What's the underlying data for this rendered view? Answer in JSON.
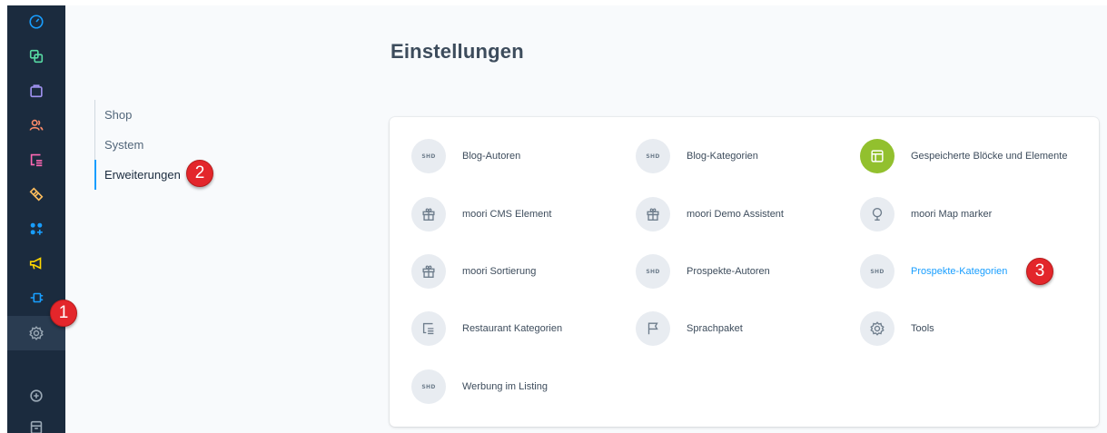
{
  "rail": {
    "items": [
      {
        "icon": "dashboard-icon",
        "color": "#189eff"
      },
      {
        "icon": "catalog-icon",
        "color": "#57d9a3"
      },
      {
        "icon": "orders-icon",
        "color": "#a092f0"
      },
      {
        "icon": "customers-icon",
        "color": "#ff8c6a"
      },
      {
        "icon": "content-icon",
        "color": "#ff68b4"
      },
      {
        "icon": "marketing-icon",
        "color": "#ffbd5d"
      },
      {
        "icon": "extensions-icon",
        "color": "#189eff"
      },
      {
        "icon": "promotions-icon",
        "color": "#ffd700"
      },
      {
        "icon": "plugins-icon",
        "color": "#189eff"
      },
      {
        "icon": "settings-icon",
        "color": "#9aa8b5"
      },
      {
        "icon": "add-icon",
        "color": "#9aa8b5"
      },
      {
        "icon": "sales-channel-icon",
        "color": "#9aa8b5"
      }
    ]
  },
  "settings": {
    "title": "Einstellungen",
    "tabs": [
      "Shop",
      "System",
      "Erweiterungen"
    ],
    "active_tab": "Erweiterungen"
  },
  "extensions": [
    {
      "label": "Blog-Autoren",
      "icon": "shd-icon",
      "icon_text": "SHD"
    },
    {
      "label": "Blog-Kategorien",
      "icon": "shd-icon",
      "icon_text": "SHD"
    },
    {
      "label": "Gespeicherte Blöcke und Elemente",
      "icon": "layout-icon",
      "icon_text": ""
    },
    {
      "label": "moori CMS Element",
      "icon": "gift-icon",
      "icon_text": ""
    },
    {
      "label": "moori Demo Assistent",
      "icon": "gift-icon",
      "icon_text": ""
    },
    {
      "label": "moori Map marker",
      "icon": "map-pin-icon",
      "icon_text": ""
    },
    {
      "label": "moori Sortierung",
      "icon": "gift-icon",
      "icon_text": ""
    },
    {
      "label": "Prospekte-Autoren",
      "icon": "shd-icon",
      "icon_text": "SHD"
    },
    {
      "label": "Prospekte-Kategorien",
      "icon": "shd-icon",
      "icon_text": "SHD"
    },
    {
      "label": "Restaurant Kategorien",
      "icon": "list-icon",
      "icon_text": ""
    },
    {
      "label": "Sprachpaket",
      "icon": "flag-icon",
      "icon_text": ""
    },
    {
      "label": "Tools",
      "icon": "gear-icon",
      "icon_text": ""
    },
    {
      "label": "Werbung im Listing",
      "icon": "shd-icon",
      "icon_text": "SHD"
    }
  ],
  "annotations": {
    "badge_1": "1",
    "badge_2": "2",
    "badge_3": "3"
  },
  "colors": {
    "accent": "#189eff",
    "sidebar": "#1b2b3e",
    "badge": "#e3262b",
    "highlight_icon": "#92c02e"
  }
}
